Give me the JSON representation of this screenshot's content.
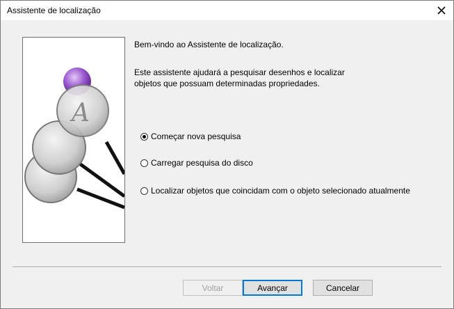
{
  "window": {
    "title": "Assistente de localização"
  },
  "content": {
    "welcome": "Bem-vindo ao Assistente de localização.",
    "description_line1": "Este assistente ajudará a pesquisar desenhos e localizar",
    "description_line2": "objetos que possuam determinadas propriedades."
  },
  "options": [
    {
      "label": "Começar nova pesquisa",
      "checked": true
    },
    {
      "label": "Carregar pesquisa do disco",
      "checked": false
    },
    {
      "label": "Localizar objetos que coincidam com o objeto selecionado atualmente",
      "checked": false
    }
  ],
  "buttons": {
    "back": "Voltar",
    "next": "Avançar",
    "cancel": "Cancelar"
  },
  "icons": {
    "close": "close-icon",
    "illustration": "magnifying-glasses-illustration"
  },
  "colors": {
    "accent": "#0078d7",
    "sphere": "#9b59d0"
  }
}
